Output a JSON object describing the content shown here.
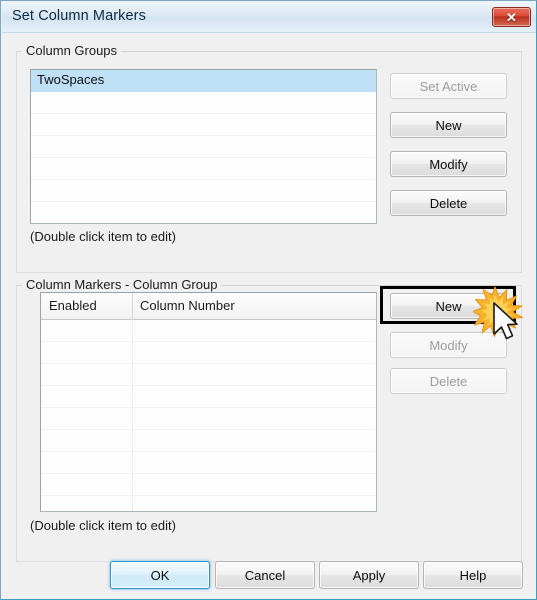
{
  "window": {
    "title": "Set Column Markers",
    "close_label": "✕",
    "close_icon": "close-icon"
  },
  "column_groups": {
    "group_label": "Column Groups",
    "items": [
      {
        "label": "TwoSpaces",
        "selected": true
      },
      {
        "label": "",
        "selected": false
      },
      {
        "label": "",
        "selected": false
      },
      {
        "label": "",
        "selected": false
      },
      {
        "label": "",
        "selected": false
      },
      {
        "label": "",
        "selected": false
      },
      {
        "label": "",
        "selected": false
      }
    ],
    "hint": "(Double click item to edit)",
    "buttons": [
      {
        "label": "Set Active",
        "enabled": false
      },
      {
        "label": "New",
        "enabled": true
      },
      {
        "label": "Modify",
        "enabled": true
      },
      {
        "label": "Delete",
        "enabled": true
      }
    ]
  },
  "column_markers": {
    "group_label": "Column Markers - Column Group",
    "columns": [
      {
        "label": "Enabled"
      },
      {
        "label": "Column Number"
      }
    ],
    "rows": [],
    "empty_row_count": 9,
    "hint": "(Double click item to edit)",
    "buttons": [
      {
        "label": "New",
        "enabled": true,
        "highlighted": true
      },
      {
        "label": "Modify",
        "enabled": false
      },
      {
        "label": "Delete",
        "enabled": false
      }
    ]
  },
  "footer": {
    "buttons": [
      {
        "label": "OK",
        "default": true
      },
      {
        "label": "Cancel",
        "default": false
      },
      {
        "label": "Apply",
        "default": false
      },
      {
        "label": "Help",
        "default": false
      }
    ]
  },
  "annotation": {
    "target": "New",
    "cursor_icon": "mouse-pointer-icon",
    "click_icon": "click-burst-icon"
  },
  "colors": {
    "titlebar_text": "#0b2b43",
    "selection": "#bfe0f7",
    "close_red": "#c6341f",
    "default_button_border": "#2c96d4",
    "burst_orange": "#f5a623",
    "annotation_black": "#000000"
  }
}
